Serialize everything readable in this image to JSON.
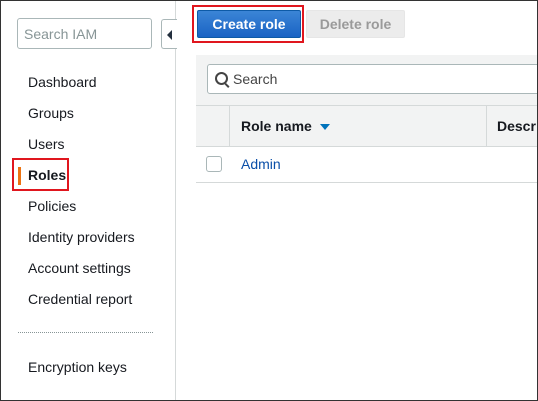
{
  "sidebar": {
    "search_placeholder": "Search IAM",
    "items": [
      {
        "label": "Dashboard"
      },
      {
        "label": "Groups"
      },
      {
        "label": "Users"
      },
      {
        "label": "Roles"
      },
      {
        "label": "Policies"
      },
      {
        "label": "Identity providers"
      },
      {
        "label": "Account settings"
      },
      {
        "label": "Credential report"
      }
    ],
    "extra_items": [
      {
        "label": "Encryption keys"
      }
    ],
    "active_item": "Roles"
  },
  "toolbar": {
    "create_label": "Create role",
    "delete_label": "Delete role"
  },
  "table": {
    "search_text": "Search",
    "columns": [
      "Role name",
      "Descr"
    ],
    "rows": [
      {
        "name": "Admin"
      }
    ]
  },
  "colors": {
    "primary_button": "#1a63c4",
    "highlight_outline": "#e0161e",
    "active_indicator": "#ec7211",
    "link": "#0b4fa8"
  },
  "icons": {
    "search": "search-icon",
    "sort": "sort-desc-icon",
    "collapse": "collapse-sidebar-icon"
  }
}
